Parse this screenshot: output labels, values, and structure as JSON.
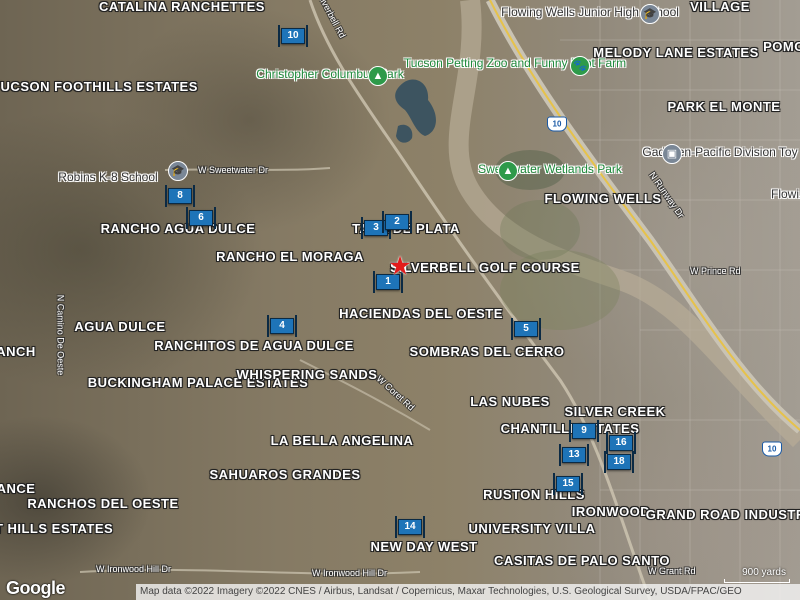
{
  "attribution": "Map data ©2022 Imagery ©2022 CNES / Airbus, Landsat / Copernicus, Maxar Technologies, U.S. Geological Survey, USDA/FPAC/GEO",
  "logo": "Google",
  "scale_label": "900 yards",
  "neighborhoods": [
    "CATALINA RANCHETTES",
    "FLOWING WELLS",
    "VILLAGE",
    "POMO",
    "MELODY LANE ESTATES",
    "PARK EL MONTE",
    "TUCSON FOOTHILLS ESTATES",
    "FLOWING WELLS",
    "RANCHO AGUA DULCE",
    "RANCHO EL MORAGA",
    "SILVERBELL GOLF COURSE",
    "AGUA DULCE",
    "HACIENDAS DEL OESTE",
    "RANCHITOS DE AGUA DULCE",
    "SOMBRAS DEL CERRO",
    "BUCKINGHAM PALACE ESTATES",
    "WHISPERING SANDS",
    "LAS NUBES",
    "SILVER CREEK",
    "CHANTILLI ESTATES",
    "LA BELLA ANGELINA",
    "SAHUAROS GRANDES",
    "RUSTON HILLS",
    "IRONWOOD",
    "GRAND ROAD INDUSTRIAL",
    "RANCHOS DEL OESTE",
    "UNIVERSITY VILLA",
    "NEW DAY WEST",
    "CASITAS DE PALO SANTO",
    "UNSET HILLS ESTATES",
    "ANCH",
    "ANCE",
    "TANA DE PLATA"
  ],
  "pois": [
    "Flowing Wells Junior High School",
    "Tucson Petting Zoo and Funny Foot Farm",
    "Christopher Columbus Park",
    "Robins K-8 School",
    "Sweetwater Wetlands Park",
    "Gadsden-Pacific Division Toy Train...",
    "Flowi..."
  ],
  "roads": [
    "Silverbell Rd",
    "W Sweetwater Dr",
    "N Camino De Oeste",
    "W Coret Rd",
    "W Prince Rd",
    "N Runway Dr",
    "W Ironwood Hill Dr",
    "W Ironwood Hill Dr",
    "W Grant Rd"
  ],
  "highway_shields": [
    "10",
    "10"
  ],
  "markers": [
    "10",
    "3",
    "2",
    "1",
    "8",
    "6",
    "4",
    "5",
    "9",
    "16",
    "13",
    "18",
    "15",
    "14"
  ]
}
